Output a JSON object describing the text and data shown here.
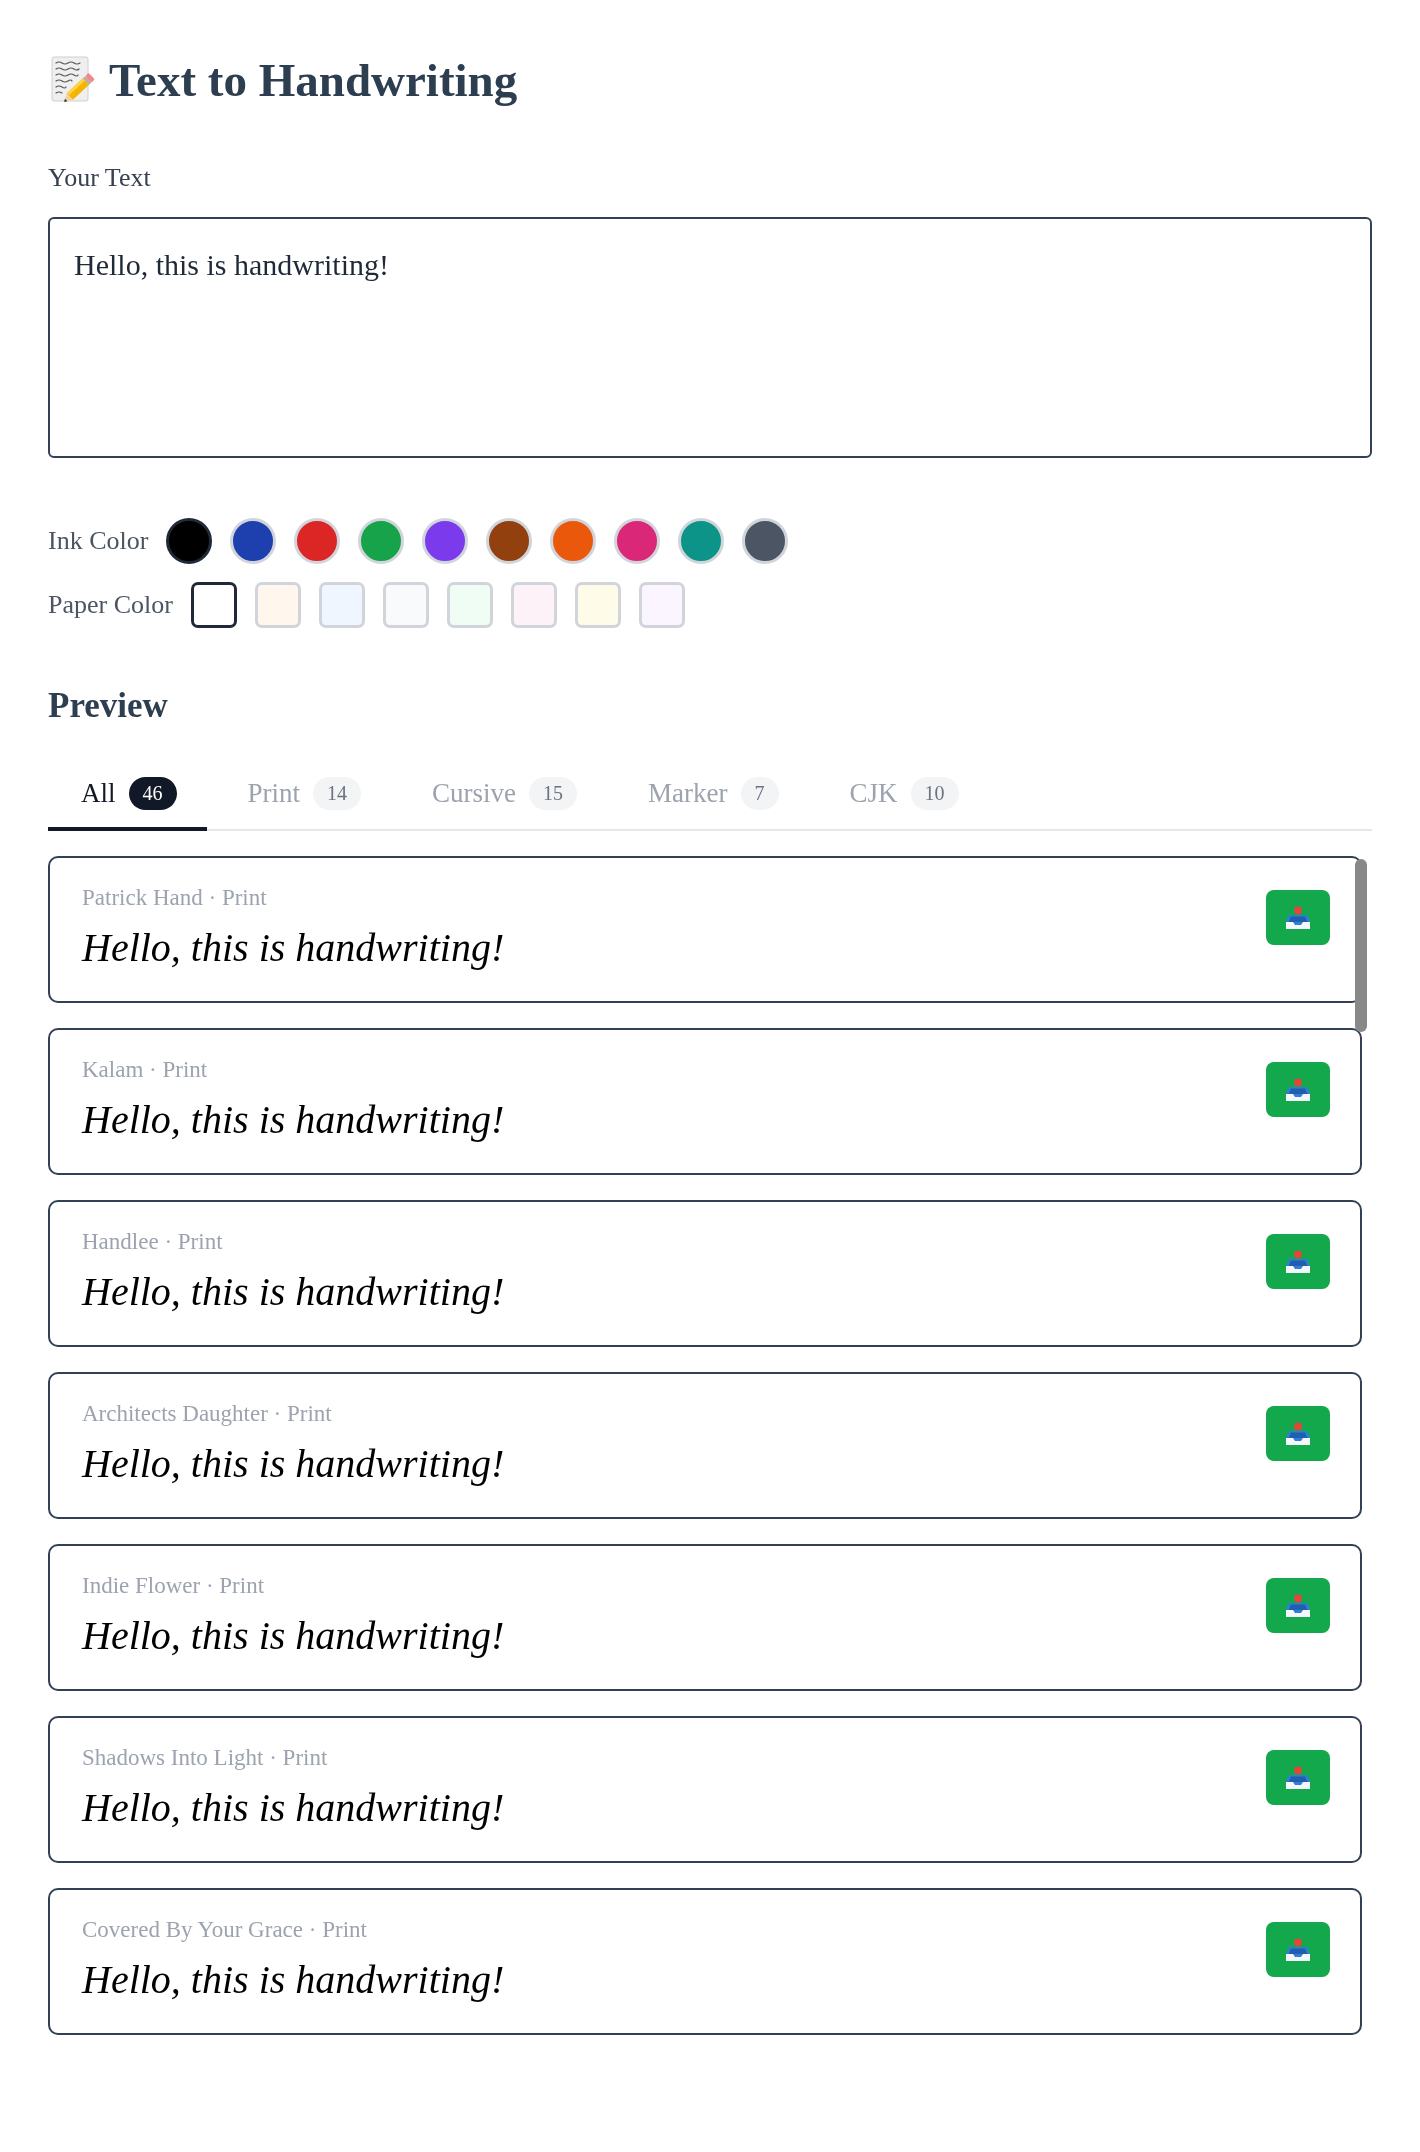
{
  "header": {
    "title": "Text to Handwriting"
  },
  "input": {
    "label": "Your Text",
    "value": "Hello, this is handwriting!"
  },
  "ink_colors": {
    "label": "Ink Color",
    "swatches": [
      {
        "color": "#000000",
        "selected": true
      },
      {
        "color": "#1e40af",
        "selected": false
      },
      {
        "color": "#dc2626",
        "selected": false
      },
      {
        "color": "#16a34a",
        "selected": false
      },
      {
        "color": "#7c3aed",
        "selected": false
      },
      {
        "color": "#92400e",
        "selected": false
      },
      {
        "color": "#ea580c",
        "selected": false
      },
      {
        "color": "#db2777",
        "selected": false
      },
      {
        "color": "#0d9488",
        "selected": false
      },
      {
        "color": "#4b5563",
        "selected": false
      }
    ]
  },
  "paper_colors": {
    "label": "Paper Color",
    "swatches": [
      {
        "color": "#ffffff",
        "selected": true
      },
      {
        "color": "#fff7ed",
        "selected": false
      },
      {
        "color": "#eff6ff",
        "selected": false
      },
      {
        "color": "#f8fafc",
        "selected": false
      },
      {
        "color": "#f0fdf4",
        "selected": false
      },
      {
        "color": "#fdf2f8",
        "selected": false
      },
      {
        "color": "#fefce8",
        "selected": false
      },
      {
        "color": "#faf5ff",
        "selected": false
      }
    ]
  },
  "preview": {
    "heading": "Preview",
    "tabs": [
      {
        "label": "All",
        "count": "46",
        "selected": true
      },
      {
        "label": "Print",
        "count": "14",
        "selected": false
      },
      {
        "label": "Cursive",
        "count": "15",
        "selected": false
      },
      {
        "label": "Marker",
        "count": "7",
        "selected": false
      },
      {
        "label": "CJK",
        "count": "10",
        "selected": false
      }
    ],
    "cards": [
      {
        "label": "Patrick Hand · Print",
        "sample": "Hello, this is handwriting!"
      },
      {
        "label": "Kalam · Print",
        "sample": "Hello, this is handwriting!"
      },
      {
        "label": "Handlee · Print",
        "sample": "Hello, this is handwriting!"
      },
      {
        "label": "Architects Daughter · Print",
        "sample": "Hello, this is handwriting!"
      },
      {
        "label": "Indie Flower · Print",
        "sample": "Hello, this is handwriting!"
      },
      {
        "label": "Shadows Into Light · Print",
        "sample": "Hello, this is handwriting!"
      },
      {
        "label": "Covered By Your Grace · Print",
        "sample": "Hello, this is handwriting!"
      }
    ]
  }
}
